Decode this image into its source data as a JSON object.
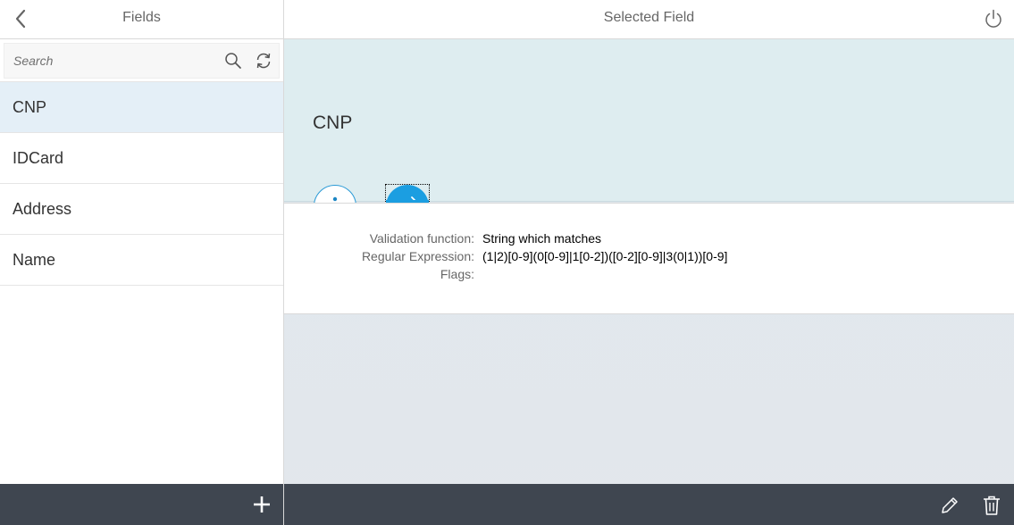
{
  "colors": {
    "accent": "#1b9ee1",
    "selected_row": "#e4eff7",
    "footer": "#3f4650",
    "object_header": "#deedf0"
  },
  "master": {
    "title": "Fields",
    "search": {
      "placeholder": "Search",
      "value": ""
    },
    "items": [
      {
        "label": "CNP",
        "selected": true
      },
      {
        "label": "IDCard",
        "selected": false
      },
      {
        "label": "Address",
        "selected": false
      },
      {
        "label": "Name",
        "selected": false
      }
    ],
    "footer": {
      "add_icon": "plus-icon"
    }
  },
  "detail": {
    "title": "Selected Field",
    "object_title": "CNP",
    "tabs": [
      {
        "icon": "info-icon",
        "selected": false
      },
      {
        "icon": "export-icon",
        "selected": true
      }
    ],
    "form": {
      "validation_label": "Validation function:",
      "validation_value": "String which matches",
      "regex_label": "Regular Expression:",
      "regex_value": "(1|2)[0-9](0[0-9]|1[0-2])([0-2][0-9]|3(0|1))[0-9]",
      "flags_label": "Flags:",
      "flags_value": ""
    },
    "footer": {
      "edit_icon": "pencil-icon",
      "delete_icon": "trash-icon"
    }
  }
}
